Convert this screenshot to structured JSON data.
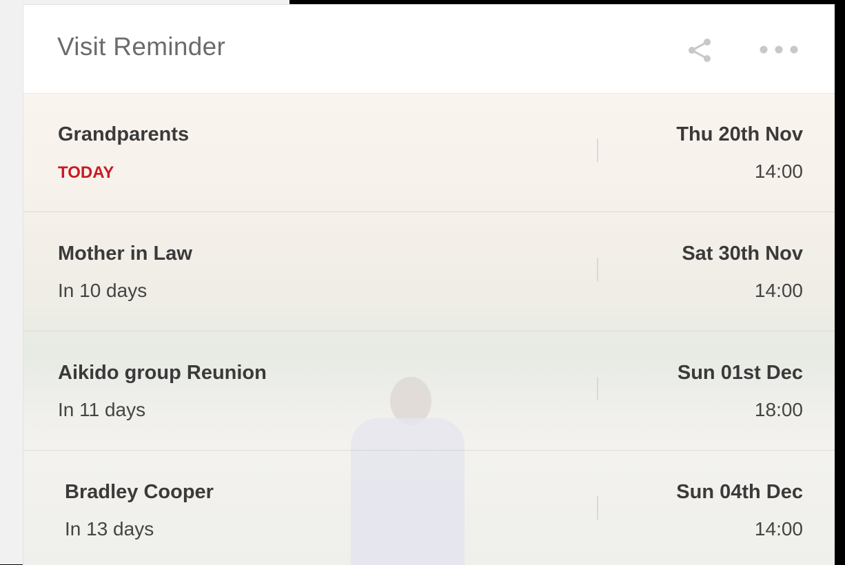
{
  "widget": {
    "title": "Visit Reminder",
    "icons": [
      "share-icon",
      "more-icon"
    ]
  },
  "colors": {
    "today": "#c81a24",
    "text": "#3a3a3a",
    "title": "#6b6b6b"
  },
  "reminders": [
    {
      "name": "Grandparents",
      "relative": "TODAY",
      "date": "Thu 20th Nov",
      "time": "14:00"
    },
    {
      "name": "Mother in Law",
      "relative": "In 10 days",
      "date": "Sat 30th Nov",
      "time": "14:00"
    },
    {
      "name": "Aikido group Reunion",
      "relative": "In 11 days",
      "date": "Sun 01st Dec",
      "time": "18:00"
    },
    {
      "name": "Bradley Cooper",
      "relative": "In 13 days",
      "date": "Sun 04th Dec",
      "time": "14:00"
    }
  ]
}
